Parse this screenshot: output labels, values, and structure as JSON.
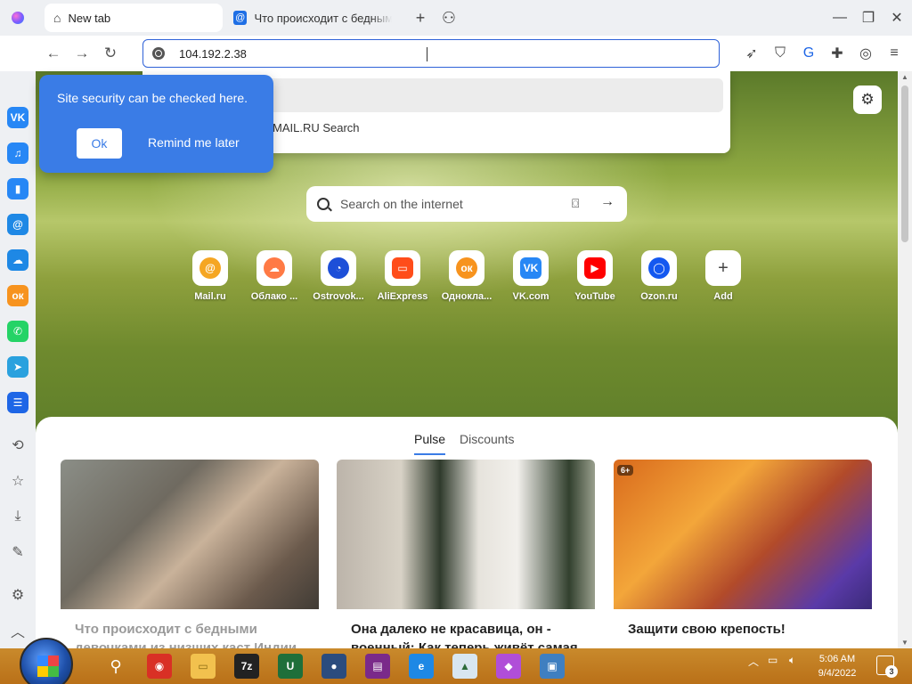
{
  "browser": {
    "tabs": [
      {
        "label": "New tab",
        "icon": "home-icon",
        "active": true
      },
      {
        "label": "Что происходит с бедными девочками из низших каст Индии",
        "icon": "mailru-at-icon",
        "active": false
      }
    ],
    "address": {
      "value": "104.192.2.38"
    }
  },
  "dropdown": {
    "engine_label": "MAIL.RU Search"
  },
  "tooltip": {
    "message": "Site security can be checked here.",
    "ok_label": "Ok",
    "later_label": "Remind me later"
  },
  "search": {
    "placeholder": "Search on the internet"
  },
  "shortcuts": [
    {
      "label": "Mail.ru",
      "icon": "mailru-icon",
      "color": "#f5a623"
    },
    {
      "label": "Облако ...",
      "icon": "cloud-icon",
      "color": "#ff7a45"
    },
    {
      "label": "Ostrovok...",
      "icon": "ostrovok-icon",
      "color": "#1d4fd8"
    },
    {
      "label": "AliExpress",
      "icon": "aliexpress-icon",
      "color": "#ff4d1a"
    },
    {
      "label": "Одноклa...",
      "icon": "odnoklassniki-icon",
      "color": "#f7931e"
    },
    {
      "label": "VK.com",
      "icon": "vk-icon",
      "color": "#2787f5"
    },
    {
      "label": "YouTube",
      "icon": "youtube-icon",
      "color": "#ff0000"
    },
    {
      "label": "Ozon.ru",
      "icon": "ozon-icon",
      "color": "#1458f0"
    },
    {
      "label": "Add",
      "icon": "plus-icon",
      "color": "#555555"
    }
  ],
  "feed": {
    "tabs": [
      "Pulse",
      "Discounts"
    ],
    "cards": [
      {
        "title": "Что происходит с бедными девочками из низших каст Индии"
      },
      {
        "title": "Она далеко не красавица, он - военный: Как теперь живёт самая"
      },
      {
        "title": "Защити свою крепость!",
        "age_badge": "6+"
      }
    ]
  },
  "sidebar": {
    "items": [
      {
        "icon": "vk-icon",
        "color": "#2787f5",
        "glyph": "VK"
      },
      {
        "icon": "music-icon",
        "color": "#2787f5",
        "glyph": "♫"
      },
      {
        "icon": "stats-icon",
        "color": "#2787f5",
        "glyph": "▮"
      },
      {
        "icon": "mail-icon",
        "color": "#1e88e5",
        "glyph": "@"
      },
      {
        "icon": "cloud-icon",
        "color": "#1e88e5",
        "glyph": "☁"
      },
      {
        "icon": "odnoklassniki-icon",
        "color": "#f7931e",
        "glyph": "ок"
      },
      {
        "icon": "whatsapp-icon",
        "color": "#25d366",
        "glyph": "✆"
      },
      {
        "icon": "telegram-icon",
        "color": "#2aa1de",
        "glyph": "➤"
      },
      {
        "icon": "tasks-icon",
        "color": "#1e66e6",
        "glyph": "☰"
      }
    ],
    "bottom": [
      {
        "icon": "history-icon",
        "glyph": "⟲"
      },
      {
        "icon": "bookmarks-icon",
        "glyph": "☆"
      },
      {
        "icon": "downloads-icon",
        "glyph": "⤓"
      },
      {
        "icon": "pen-icon",
        "glyph": "✎"
      },
      {
        "icon": "settings-icon",
        "glyph": "⚙"
      },
      {
        "icon": "collapse-icon",
        "glyph": "︿"
      }
    ]
  },
  "taskbar": {
    "apps": [
      {
        "icon": "search-icon",
        "glyph": "⚲",
        "color": "transparent"
      },
      {
        "icon": "chrome-icon",
        "glyph": "◉",
        "color": "#d93025"
      },
      {
        "icon": "explorer-icon",
        "glyph": "▭",
        "color": "#f2c14e"
      },
      {
        "icon": "7zip-icon",
        "glyph": "7z",
        "color": "#222222"
      },
      {
        "icon": "utorrent-icon",
        "glyph": "U",
        "color": "#1f6f3a"
      },
      {
        "icon": "vpn-icon",
        "glyph": "●",
        "color": "#2b4c7e"
      },
      {
        "icon": "winrar-icon",
        "glyph": "▤",
        "color": "#7a2a8a"
      },
      {
        "icon": "edge-icon",
        "glyph": "e",
        "color": "#1e88e5"
      },
      {
        "icon": "photos-icon",
        "glyph": "▲",
        "color": "#d8e6f0"
      },
      {
        "icon": "atom-browser-icon",
        "glyph": "◆",
        "color": "#b04ed8"
      },
      {
        "icon": "network-app-icon",
        "glyph": "▣",
        "color": "#3f7fc0"
      }
    ],
    "clock": {
      "time": "5:06 AM",
      "date": "9/4/2022"
    },
    "notifications": "3"
  }
}
